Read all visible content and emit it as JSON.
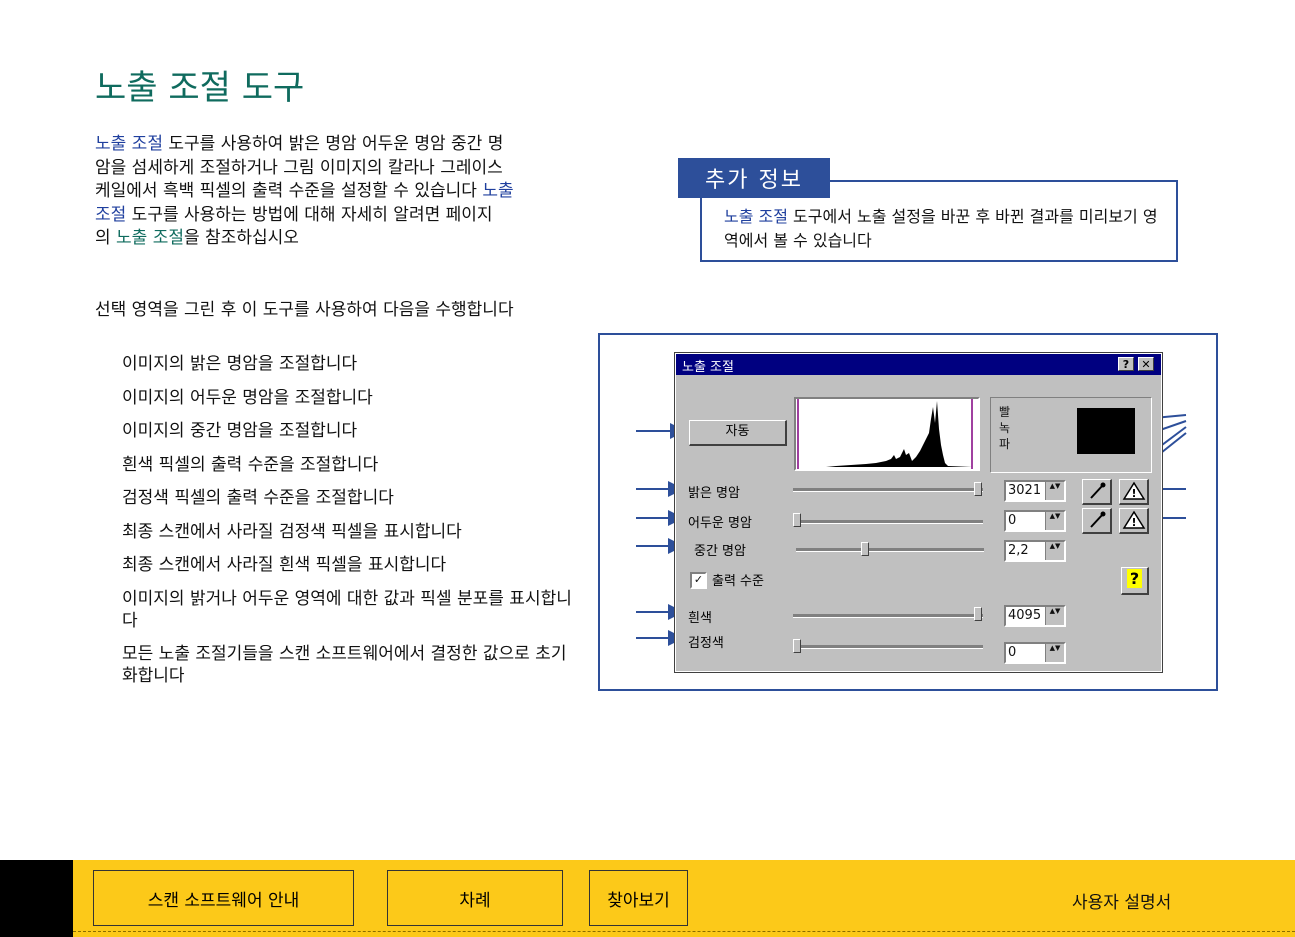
{
  "page": {
    "title": "노출 조절 도구"
  },
  "intro": {
    "line1_a": "노출 조절",
    "line1_b": " 도구를 사용하여  밝은 명암  어두운 명암  중간 명",
    "line2": "암을 섬세하게  조절하거나  그림 이미지의  칼라나 그레이스",
    "line3_a": "케일에서  흑백 픽셀의  출력  수준을 설정할  수 있습니다  ",
    "line3_b": "노출",
    "line4_a": "조절",
    "line4_b": " 도구를 사용하는  방법에  대해 자세히  알려면      페이지",
    "line5_a": "의 ",
    "line5_b": "노출 조절",
    "line5_c": "을 참조하십시오"
  },
  "tasks": {
    "lead": "선택 영역을  그린 후 이 도구를 사용하여  다음을  수행합니다",
    "items": [
      "이미지의 밝은 명암을 조절합니다",
      "이미지의 어두운 명암을 조절합니다",
      "이미지의 중간 명암을 조절합니다",
      "흰색 픽셀의 출력 수준을 조절합니다",
      "검정색 픽셀의 출력 수준을 조절합니다",
      "최종 스캔에서 사라질 검정색 픽셀을 표시합니다",
      "최종 스캔에서 사라질 흰색 픽셀을 표시합니다",
      "이미지의 밝거나 어두운 영역에 대한        값과 픽셀 분포를 표시합니다",
      "모든 노출 조절기들을 스캔 소프트웨어에서 결정한 값으로 초기화합니다"
    ]
  },
  "info": {
    "tab_label": "추가 정보",
    "text_a": "노출 조절",
    "text_b": " 도구에서 노출 설정을 바꾼 후 바뀐 결과를 미리보기 영역에서 볼 수 있습니다"
  },
  "dialog": {
    "title": "노출 조절",
    "help_btn": "?",
    "close_btn": "✕",
    "auto_btn": "자동",
    "channel_labels": "빨\n녹\n파",
    "highlight_label": "밝은 명암",
    "highlight_value": "3021",
    "shadow_label": "어두운 명암",
    "shadow_value": "0",
    "midtone_label": "중간 명암",
    "midtone_value": "2,2",
    "output_checkbox": "출력 수준",
    "white_label": "흰색",
    "white_value": "4095",
    "black_label": "검정색",
    "black_value": "0",
    "question_btn": "?",
    "warning_glyph": "!",
    "checkbox_mark": "✓",
    "spin_arrows": "▲▼",
    "highlight_level": 1.0,
    "shadow_level": 0.0,
    "midtone_level": 0.38,
    "white_level": 1.0,
    "black_level": 0.0
  },
  "footer": {
    "nav1": "스캔 소프트웨어  안내",
    "nav2": "차례",
    "nav3": "찾아보기",
    "manual": "사용자 설명서"
  },
  "colors": {
    "accent_blue": "#2d4f9a",
    "title_green": "#0f6b5e",
    "footer_yellow": "#fcc919",
    "titlebar": "#000080"
  }
}
